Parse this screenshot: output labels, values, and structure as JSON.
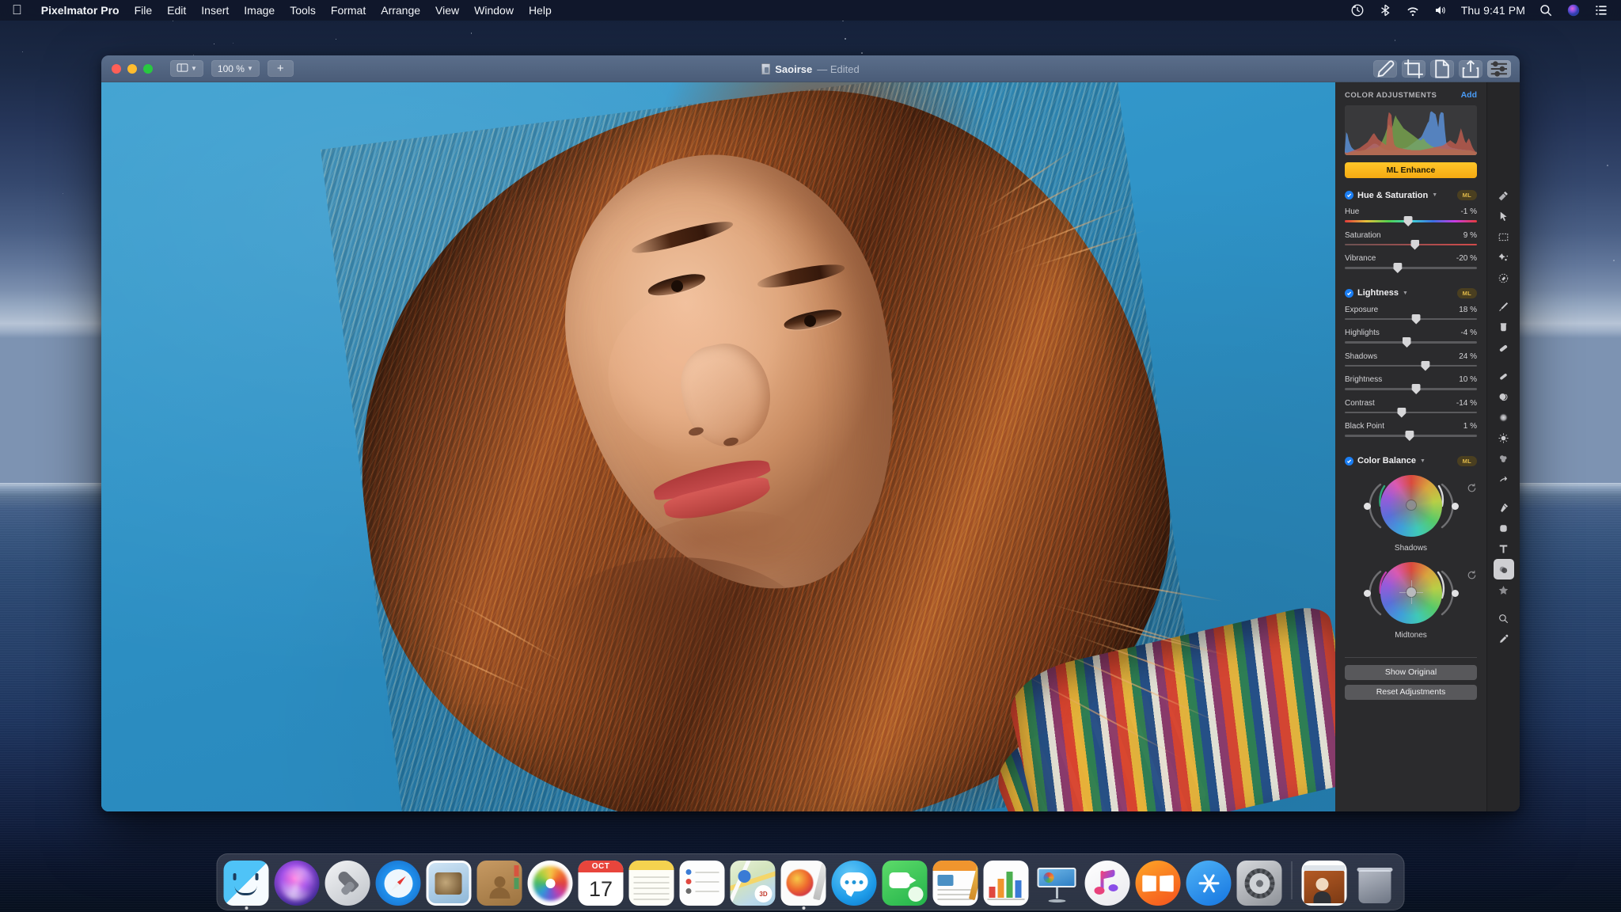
{
  "menubar": {
    "apple_icon": "apple-logo-icon",
    "items": [
      {
        "label": "Pixelmator Pro",
        "bold": true
      },
      {
        "label": "File",
        "bold": false
      },
      {
        "label": "Edit",
        "bold": false
      },
      {
        "label": "Insert",
        "bold": false
      },
      {
        "label": "Image",
        "bold": false
      },
      {
        "label": "Tools",
        "bold": false
      },
      {
        "label": "Format",
        "bold": false
      },
      {
        "label": "Arrange",
        "bold": false
      },
      {
        "label": "View",
        "bold": false
      },
      {
        "label": "Window",
        "bold": false
      },
      {
        "label": "Help",
        "bold": false
      }
    ],
    "status_icons": [
      "time-machine-icon",
      "bluetooth-icon",
      "wifi-icon",
      "volume-icon"
    ],
    "clock": "Thu 9:41 PM",
    "right_icons": [
      "search-icon",
      "siri-icon",
      "control-center-icon"
    ]
  },
  "window": {
    "traffic_lights": [
      "close",
      "minimize",
      "zoom"
    ],
    "layout_button_label": "",
    "zoom_level": "100 %",
    "add_button_label": "+",
    "doc_title": "Saoirse",
    "doc_state": "— Edited",
    "toolbar_buttons": [
      {
        "name": "repair-tool-button",
        "active": false
      },
      {
        "name": "crop-tool-button",
        "active": false
      },
      {
        "name": "document-tool-button",
        "active": false
      },
      {
        "name": "share-button",
        "active": false
      },
      {
        "name": "adjustments-toggle-button",
        "active": true
      }
    ]
  },
  "sidebar": {
    "section_title": "COLOR ADJUSTMENTS",
    "add_label": "Add",
    "ml_enhance_label": "ML Enhance",
    "ml_badge": "ML",
    "groups": [
      {
        "name": "Hue & Saturation",
        "enabled": true,
        "sliders": [
          {
            "label": "Hue",
            "value": "-1 %",
            "pos": 48,
            "track": "hue"
          },
          {
            "label": "Saturation",
            "value": "9 %",
            "pos": 53,
            "track": "sat"
          },
          {
            "label": "Vibrance",
            "value": "-20 %",
            "pos": 40,
            "track": "plain"
          }
        ]
      },
      {
        "name": "Lightness",
        "enabled": true,
        "sliders": [
          {
            "label": "Exposure",
            "value": "18 %",
            "pos": 54,
            "track": "plain"
          },
          {
            "label": "Highlights",
            "value": "-4 %",
            "pos": 47,
            "track": "plain"
          },
          {
            "label": "Shadows",
            "value": "24 %",
            "pos": 61,
            "track": "plain"
          },
          {
            "label": "Brightness",
            "value": "10 %",
            "pos": 54,
            "track": "plain"
          },
          {
            "label": "Contrast",
            "value": "-14 %",
            "pos": 43,
            "track": "plain"
          },
          {
            "label": "Black Point",
            "value": "1 %",
            "pos": 49,
            "track": "plain"
          }
        ]
      },
      {
        "name": "Color Balance",
        "enabled": true,
        "wheels": [
          {
            "label": "Shadows",
            "arc_color": "#2fa87a",
            "arc_side": "left"
          },
          {
            "label": "Midtones",
            "arc_color": "#c13fb0",
            "arc_side": "left"
          }
        ]
      }
    ],
    "show_original_label": "Show Original",
    "reset_adjustments_label": "Reset Adjustments",
    "accent_blue": "#1b7ef3",
    "ml_orange": "#ffc629"
  },
  "toolstrip": {
    "tools": [
      {
        "name": "repair-tool",
        "active": false
      },
      {
        "name": "arrow-select-tool",
        "active": false
      },
      {
        "name": "rectangular-marquee-tool",
        "active": false
      },
      {
        "name": "quick-selection-tool",
        "active": false
      },
      {
        "name": "paint-selection-tool",
        "active": false
      },
      {
        "name": "paint-brush-tool",
        "active": false
      },
      {
        "name": "paint-bucket-tool",
        "active": false
      },
      {
        "name": "eraser-tool",
        "active": false
      },
      {
        "name": "pencil-tool",
        "active": false
      },
      {
        "name": "clone-stamp-tool",
        "active": false
      },
      {
        "name": "blur-tool",
        "active": false
      },
      {
        "name": "lighten-tool",
        "active": false
      },
      {
        "name": "smudge-tool",
        "active": false
      },
      {
        "name": "pinch-tool",
        "active": false
      },
      {
        "name": "pen-tool",
        "active": false
      },
      {
        "name": "shape-tool",
        "active": false
      },
      {
        "name": "type-tool",
        "active": false
      },
      {
        "name": "color-adjustments-tool",
        "active": true
      },
      {
        "name": "effects-tool",
        "active": false
      },
      {
        "name": "zoom-tool",
        "active": false
      },
      {
        "name": "color-picker-tool",
        "active": false
      }
    ]
  },
  "dock": {
    "items": [
      {
        "name": "finder",
        "running": true
      },
      {
        "name": "siri",
        "running": false
      },
      {
        "name": "launchpad",
        "running": false
      },
      {
        "name": "safari",
        "running": false
      },
      {
        "name": "mail",
        "running": false
      },
      {
        "name": "contacts",
        "running": false
      },
      {
        "name": "photos",
        "running": false
      },
      {
        "name": "calendar",
        "running": false,
        "month": "OCT",
        "day": "17"
      },
      {
        "name": "notes",
        "running": false
      },
      {
        "name": "reminders",
        "running": false
      },
      {
        "name": "maps",
        "running": false
      },
      {
        "name": "pixelmator-pro",
        "running": true
      },
      {
        "name": "messages",
        "running": false
      },
      {
        "name": "facetime",
        "running": false
      },
      {
        "name": "pages",
        "running": false
      },
      {
        "name": "numbers",
        "running": false
      },
      {
        "name": "keynote",
        "running": false
      },
      {
        "name": "itunes",
        "running": false
      },
      {
        "name": "books",
        "running": false
      },
      {
        "name": "app-store",
        "running": false
      },
      {
        "name": "system-preferences",
        "running": false
      },
      {
        "name": "downloads-stack",
        "running": false
      },
      {
        "name": "trash",
        "running": false
      }
    ]
  },
  "histogram": {
    "red": [
      6,
      5,
      5,
      6,
      7,
      8,
      9,
      10,
      11,
      12,
      13,
      14,
      16,
      18,
      20,
      22,
      24,
      26,
      30,
      34,
      38,
      42,
      44,
      40,
      36,
      32,
      30,
      28,
      26,
      24,
      22,
      20,
      70,
      86,
      84,
      80,
      40,
      22,
      18,
      16,
      15,
      14,
      14,
      13,
      13,
      12,
      12,
      11,
      11,
      11,
      10,
      10,
      10,
      10,
      10,
      10,
      10,
      10,
      11,
      11,
      12,
      12,
      13,
      13,
      14,
      14,
      15,
      16,
      16,
      17,
      17,
      18,
      18,
      19,
      20,
      22,
      24,
      26,
      28,
      30,
      28,
      26,
      24,
      22,
      26,
      34,
      44,
      54,
      46,
      36,
      28,
      24,
      30,
      34,
      28,
      20,
      14,
      10,
      7,
      5
    ],
    "green": [
      4,
      4,
      4,
      5,
      5,
      6,
      6,
      7,
      7,
      8,
      8,
      9,
      9,
      10,
      10,
      11,
      11,
      12,
      12,
      13,
      13,
      14,
      14,
      15,
      15,
      16,
      18,
      22,
      28,
      34,
      40,
      48,
      56,
      62,
      58,
      54,
      60,
      72,
      80,
      74,
      70,
      66,
      62,
      58,
      54,
      52,
      50,
      48,
      46,
      44,
      42,
      40,
      38,
      36,
      34,
      32,
      30,
      30,
      32,
      34,
      30,
      26,
      24,
      22,
      20,
      18,
      17,
      16,
      16,
      15,
      15,
      14,
      14,
      13,
      13,
      13,
      12,
      12,
      12,
      12,
      12,
      12,
      12,
      11,
      11,
      11,
      11,
      11,
      10,
      10,
      10,
      10,
      10,
      10,
      9,
      9,
      8,
      7,
      6,
      5
    ],
    "blue": [
      10,
      46,
      42,
      30,
      22,
      16,
      13,
      11,
      10,
      9,
      9,
      8,
      8,
      8,
      9,
      10,
      12,
      14,
      16,
      18,
      20,
      22,
      23,
      23,
      22,
      20,
      18,
      16,
      14,
      13,
      12,
      11,
      10,
      10,
      10,
      10,
      10,
      10,
      11,
      11,
      12,
      12,
      13,
      13,
      14,
      14,
      15,
      16,
      18,
      20,
      22,
      24,
      26,
      28,
      30,
      32,
      34,
      36,
      40,
      46,
      52,
      58,
      64,
      68,
      86,
      88,
      86,
      84,
      82,
      70,
      56,
      80,
      86,
      86,
      84,
      50,
      26,
      20,
      18,
      16,
      15,
      14,
      14,
      13,
      13,
      12,
      12,
      12,
      11,
      11,
      11,
      10,
      10,
      10,
      10,
      9,
      8,
      7,
      6,
      5
    ]
  }
}
